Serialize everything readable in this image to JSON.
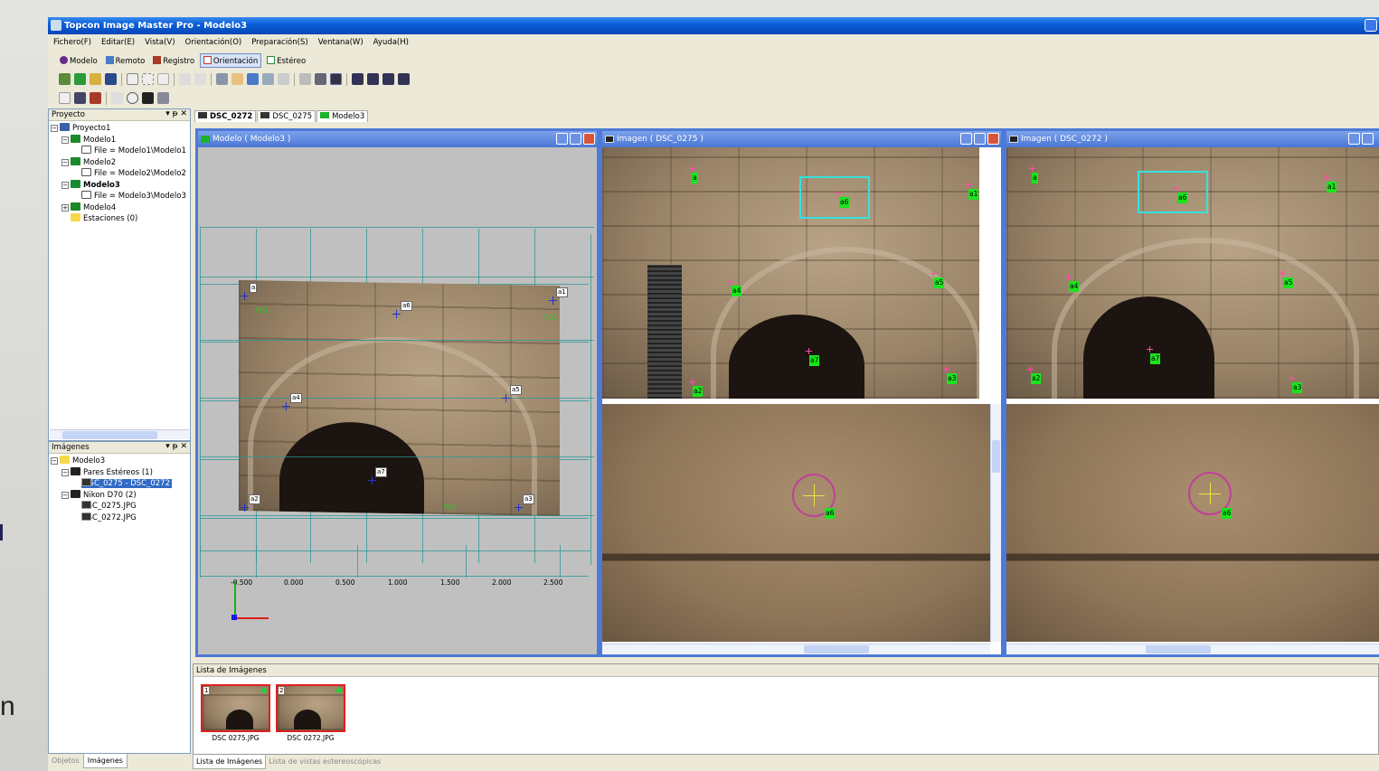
{
  "app": {
    "title": "Topcon Image Master Pro - Modelo3"
  },
  "slide_fragment_text": "n",
  "menu": [
    "Fichero(F)",
    "Editar(E)",
    "Vista(V)",
    "Orientación(O)",
    "Preparación(S)",
    "Ventana(W)",
    "Ayuda(H)"
  ],
  "modes": [
    {
      "label": "Modelo",
      "icon": "model-icon",
      "active": false
    },
    {
      "label": "Remoto",
      "icon": "remote-icon",
      "active": false
    },
    {
      "label": "Registro",
      "icon": "register-icon",
      "active": false
    },
    {
      "label": "Orientación",
      "icon": "orientation-icon",
      "active": true
    },
    {
      "label": "Estéreo",
      "icon": "stereo-icon",
      "active": false
    }
  ],
  "proyecto_panel": {
    "title": "Proyecto",
    "controls": "▾ ᵽ ✕",
    "tree": [
      {
        "label": "Proyecto1",
        "icon": "project-icon",
        "depth": 0,
        "exp": "−"
      },
      {
        "label": "Modelo1",
        "icon": "model-icon",
        "depth": 1,
        "exp": "−"
      },
      {
        "label": "File = Modelo1\\Modelo1",
        "icon": "file-icon",
        "depth": 2,
        "exp": ""
      },
      {
        "label": "Modelo2",
        "icon": "model-icon",
        "depth": 1,
        "exp": "−"
      },
      {
        "label": "File = Modelo2\\Modelo2",
        "icon": "file-icon",
        "depth": 2,
        "exp": ""
      },
      {
        "label": "Modelo3",
        "icon": "model-icon",
        "depth": 1,
        "exp": "−",
        "bold": true
      },
      {
        "label": "File = Modelo3\\Modelo3",
        "icon": "file-icon",
        "depth": 2,
        "exp": ""
      },
      {
        "label": "Modelo4",
        "icon": "model-icon",
        "depth": 1,
        "exp": "+"
      },
      {
        "label": "Estaciones (0)",
        "icon": "folder-icon",
        "depth": 1,
        "exp": ""
      }
    ]
  },
  "imagenes_panel": {
    "title": "Imágenes",
    "controls": "▾ ᵽ ✕",
    "tree": [
      {
        "label": "Modelo3",
        "icon": "folder-icon",
        "depth": 0,
        "exp": "−"
      },
      {
        "label": "Pares Estéreos (1)",
        "icon": "stereo-pair-icon",
        "depth": 1,
        "exp": "−"
      },
      {
        "label": "DSC_0275 - DSC_0272",
        "icon": "photo-icon",
        "depth": 2,
        "exp": "",
        "selected": true
      },
      {
        "label": "Nikon D70 (2)",
        "icon": "camera-icon",
        "depth": 1,
        "exp": "−"
      },
      {
        "label": "DSC_0275.JPG",
        "icon": "photo-icon",
        "depth": 2,
        "exp": ""
      },
      {
        "label": "DSC_0272.JPG",
        "icon": "photo-icon",
        "depth": 2,
        "exp": ""
      }
    ]
  },
  "left_tabs": [
    "Objetos",
    "Imágenes"
  ],
  "doc_tabs": [
    "DSC_0272",
    "DSC_0275",
    "Modelo3"
  ],
  "windows": {
    "modelo": "Modelo ( Modelo3 )",
    "img1": "Imagen ( DSC_0275 )",
    "img2": "Imagen ( DSC_0272 )"
  },
  "model_axis_ticks": [
    "-0.500",
    "0.000",
    "0.500",
    "1.000",
    "1.500",
    "2.000",
    "2.500"
  ],
  "model_points": [
    "a",
    "a1",
    "a6",
    "a4",
    "a5",
    "a7",
    "a2",
    "a3"
  ],
  "model_refs": [
    "P01",
    "P02",
    "P03"
  ],
  "img1_points": [
    "a",
    "a1",
    "a6",
    "a4",
    "a5",
    "a7",
    "a2",
    "a3"
  ],
  "img2_points": [
    "a",
    "a1",
    "a6",
    "a4",
    "a5",
    "a7",
    "a2",
    "a3"
  ],
  "closeup_label": "a6",
  "lista": {
    "title": "Lista de Imágenes",
    "items": [
      {
        "num": "1",
        "caption": "DSC 0275.JPG"
      },
      {
        "num": "2",
        "caption": "DSC 0272.JPG"
      }
    ]
  },
  "bottom_tabs": [
    "Lista de Imágenes",
    "Lista de vistas estereoscópicas"
  ]
}
